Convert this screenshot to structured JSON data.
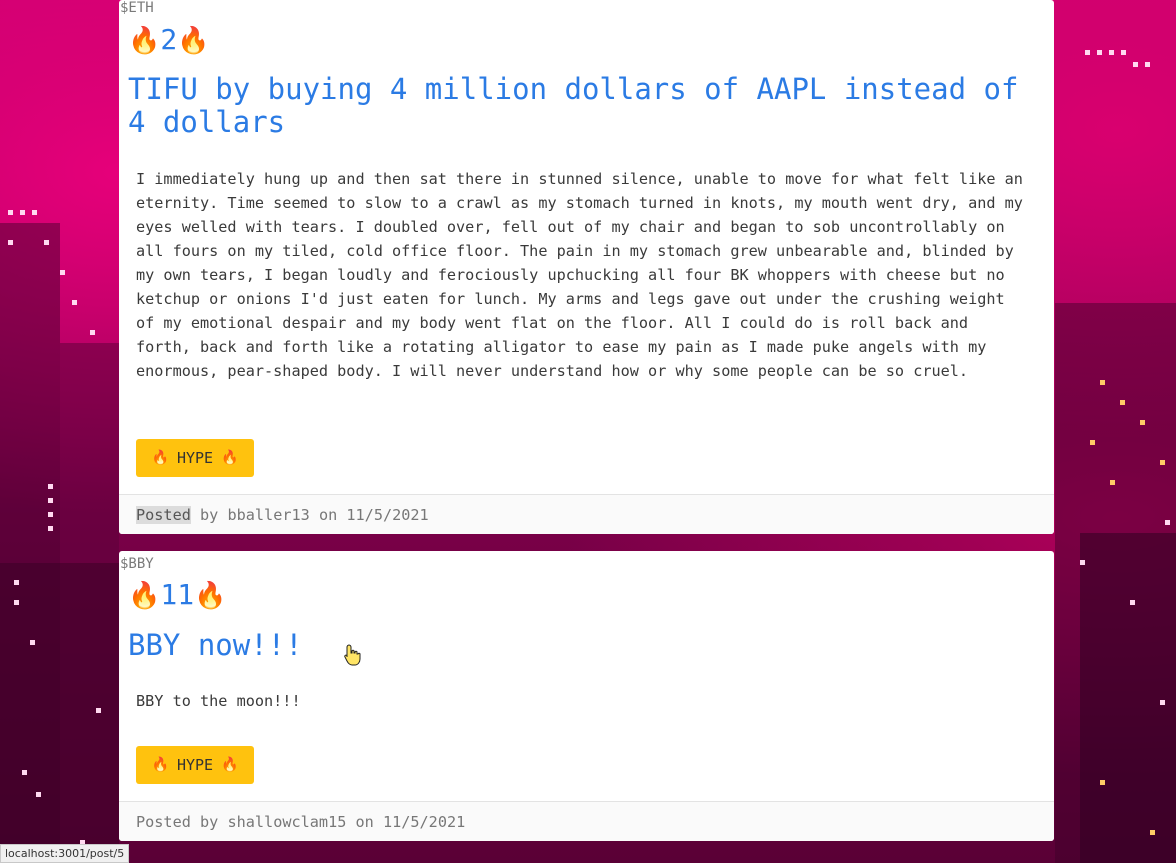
{
  "posts": [
    {
      "ticker": "$ETH",
      "score": "2",
      "title": "TIFU by buying 4 million dollars of AAPL instead of 4 dollars",
      "body": "I immediately hung up and then sat there in stunned silence, unable to move for what felt like an eternity. Time seemed to slow to a crawl as my stomach turned in knots, my mouth went dry, and my eyes welled with tears. I doubled over, fell out of my chair and began to sob uncontrollably on all fours on my tiled, cold office floor. The pain in my stomach grew unbearable and, blinded by my own tears, I began loudly and ferociously upchucking all four BK whoppers with cheese but no ketchup or onions I'd just eaten for lunch. My arms and legs gave out under the crushing weight of my emotional despair and my body went flat on the floor. All I could do is roll back and forth, back and forth like a rotating alligator to ease my pain as I made puke angels with my enormous, pear-shaped body. I will never understand how or why some people can be so cruel.",
      "hype_label": "HYPE",
      "posted_word": "Posted",
      "by_word": "by",
      "author": "bballer13",
      "on_word": "on",
      "date": "11/5/2021"
    },
    {
      "ticker": "$BBY",
      "score": "11",
      "title": "BBY now!!!",
      "body": "BBY to the moon!!!",
      "hype_label": "HYPE",
      "posted_word": "Posted",
      "by_word": "by",
      "author": "shallowclam15",
      "on_word": "on",
      "date": "11/5/2021"
    }
  ],
  "status_bar": {
    "url": "localhost:3001/post/5"
  },
  "icons": {
    "fire": "fire-icon",
    "cursor": "hand-pointer-icon"
  },
  "colors": {
    "title": "#2b7be4",
    "hype_button": "#ffc20e",
    "background": "#9d0058"
  }
}
